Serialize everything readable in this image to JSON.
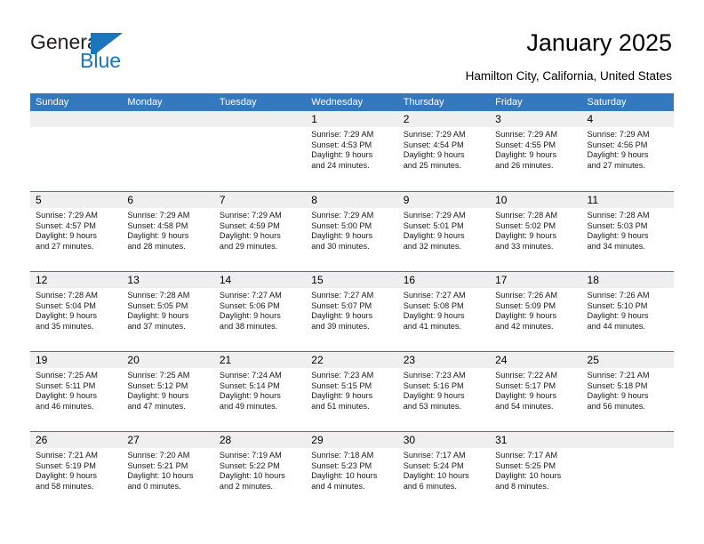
{
  "brand": {
    "name_top": "General",
    "name_bottom": "Blue",
    "mark": "triangle-logo-mark",
    "color": "#1b75bb"
  },
  "header": {
    "title": "January 2025",
    "subtitle": "Hamilton City, California, United States"
  },
  "theme": {
    "header_blue": "#3478bd",
    "daynum_band": "#efefef",
    "text": "#000000"
  },
  "calendar": {
    "day_headers": [
      "Sunday",
      "Monday",
      "Tuesday",
      "Wednesday",
      "Thursday",
      "Friday",
      "Saturday"
    ],
    "weeks": [
      [
        {
          "day": "",
          "empty": true
        },
        {
          "day": "",
          "empty": true
        },
        {
          "day": "",
          "empty": true
        },
        {
          "day": "1",
          "sunrise": "Sunrise: 7:29 AM",
          "sunset": "Sunset: 4:53 PM",
          "daylight_1": "Daylight: 9 hours",
          "daylight_2": "and 24 minutes."
        },
        {
          "day": "2",
          "sunrise": "Sunrise: 7:29 AM",
          "sunset": "Sunset: 4:54 PM",
          "daylight_1": "Daylight: 9 hours",
          "daylight_2": "and 25 minutes."
        },
        {
          "day": "3",
          "sunrise": "Sunrise: 7:29 AM",
          "sunset": "Sunset: 4:55 PM",
          "daylight_1": "Daylight: 9 hours",
          "daylight_2": "and 26 minutes."
        },
        {
          "day": "4",
          "sunrise": "Sunrise: 7:29 AM",
          "sunset": "Sunset: 4:56 PM",
          "daylight_1": "Daylight: 9 hours",
          "daylight_2": "and 27 minutes."
        }
      ],
      [
        {
          "day": "5",
          "sunrise": "Sunrise: 7:29 AM",
          "sunset": "Sunset: 4:57 PM",
          "daylight_1": "Daylight: 9 hours",
          "daylight_2": "and 27 minutes."
        },
        {
          "day": "6",
          "sunrise": "Sunrise: 7:29 AM",
          "sunset": "Sunset: 4:58 PM",
          "daylight_1": "Daylight: 9 hours",
          "daylight_2": "and 28 minutes."
        },
        {
          "day": "7",
          "sunrise": "Sunrise: 7:29 AM",
          "sunset": "Sunset: 4:59 PM",
          "daylight_1": "Daylight: 9 hours",
          "daylight_2": "and 29 minutes."
        },
        {
          "day": "8",
          "sunrise": "Sunrise: 7:29 AM",
          "sunset": "Sunset: 5:00 PM",
          "daylight_1": "Daylight: 9 hours",
          "daylight_2": "and 30 minutes."
        },
        {
          "day": "9",
          "sunrise": "Sunrise: 7:29 AM",
          "sunset": "Sunset: 5:01 PM",
          "daylight_1": "Daylight: 9 hours",
          "daylight_2": "and 32 minutes."
        },
        {
          "day": "10",
          "sunrise": "Sunrise: 7:28 AM",
          "sunset": "Sunset: 5:02 PM",
          "daylight_1": "Daylight: 9 hours",
          "daylight_2": "and 33 minutes."
        },
        {
          "day": "11",
          "sunrise": "Sunrise: 7:28 AM",
          "sunset": "Sunset: 5:03 PM",
          "daylight_1": "Daylight: 9 hours",
          "daylight_2": "and 34 minutes."
        }
      ],
      [
        {
          "day": "12",
          "sunrise": "Sunrise: 7:28 AM",
          "sunset": "Sunset: 5:04 PM",
          "daylight_1": "Daylight: 9 hours",
          "daylight_2": "and 35 minutes."
        },
        {
          "day": "13",
          "sunrise": "Sunrise: 7:28 AM",
          "sunset": "Sunset: 5:05 PM",
          "daylight_1": "Daylight: 9 hours",
          "daylight_2": "and 37 minutes."
        },
        {
          "day": "14",
          "sunrise": "Sunrise: 7:27 AM",
          "sunset": "Sunset: 5:06 PM",
          "daylight_1": "Daylight: 9 hours",
          "daylight_2": "and 38 minutes."
        },
        {
          "day": "15",
          "sunrise": "Sunrise: 7:27 AM",
          "sunset": "Sunset: 5:07 PM",
          "daylight_1": "Daylight: 9 hours",
          "daylight_2": "and 39 minutes."
        },
        {
          "day": "16",
          "sunrise": "Sunrise: 7:27 AM",
          "sunset": "Sunset: 5:08 PM",
          "daylight_1": "Daylight: 9 hours",
          "daylight_2": "and 41 minutes."
        },
        {
          "day": "17",
          "sunrise": "Sunrise: 7:26 AM",
          "sunset": "Sunset: 5:09 PM",
          "daylight_1": "Daylight: 9 hours",
          "daylight_2": "and 42 minutes."
        },
        {
          "day": "18",
          "sunrise": "Sunrise: 7:26 AM",
          "sunset": "Sunset: 5:10 PM",
          "daylight_1": "Daylight: 9 hours",
          "daylight_2": "and 44 minutes."
        }
      ],
      [
        {
          "day": "19",
          "sunrise": "Sunrise: 7:25 AM",
          "sunset": "Sunset: 5:11 PM",
          "daylight_1": "Daylight: 9 hours",
          "daylight_2": "and 46 minutes."
        },
        {
          "day": "20",
          "sunrise": "Sunrise: 7:25 AM",
          "sunset": "Sunset: 5:12 PM",
          "daylight_1": "Daylight: 9 hours",
          "daylight_2": "and 47 minutes."
        },
        {
          "day": "21",
          "sunrise": "Sunrise: 7:24 AM",
          "sunset": "Sunset: 5:14 PM",
          "daylight_1": "Daylight: 9 hours",
          "daylight_2": "and 49 minutes."
        },
        {
          "day": "22",
          "sunrise": "Sunrise: 7:23 AM",
          "sunset": "Sunset: 5:15 PM",
          "daylight_1": "Daylight: 9 hours",
          "daylight_2": "and 51 minutes."
        },
        {
          "day": "23",
          "sunrise": "Sunrise: 7:23 AM",
          "sunset": "Sunset: 5:16 PM",
          "daylight_1": "Daylight: 9 hours",
          "daylight_2": "and 53 minutes."
        },
        {
          "day": "24",
          "sunrise": "Sunrise: 7:22 AM",
          "sunset": "Sunset: 5:17 PM",
          "daylight_1": "Daylight: 9 hours",
          "daylight_2": "and 54 minutes."
        },
        {
          "day": "25",
          "sunrise": "Sunrise: 7:21 AM",
          "sunset": "Sunset: 5:18 PM",
          "daylight_1": "Daylight: 9 hours",
          "daylight_2": "and 56 minutes."
        }
      ],
      [
        {
          "day": "26",
          "sunrise": "Sunrise: 7:21 AM",
          "sunset": "Sunset: 5:19 PM",
          "daylight_1": "Daylight: 9 hours",
          "daylight_2": "and 58 minutes."
        },
        {
          "day": "27",
          "sunrise": "Sunrise: 7:20 AM",
          "sunset": "Sunset: 5:21 PM",
          "daylight_1": "Daylight: 10 hours",
          "daylight_2": "and 0 minutes."
        },
        {
          "day": "28",
          "sunrise": "Sunrise: 7:19 AM",
          "sunset": "Sunset: 5:22 PM",
          "daylight_1": "Daylight: 10 hours",
          "daylight_2": "and 2 minutes."
        },
        {
          "day": "29",
          "sunrise": "Sunrise: 7:18 AM",
          "sunset": "Sunset: 5:23 PM",
          "daylight_1": "Daylight: 10 hours",
          "daylight_2": "and 4 minutes."
        },
        {
          "day": "30",
          "sunrise": "Sunrise: 7:17 AM",
          "sunset": "Sunset: 5:24 PM",
          "daylight_1": "Daylight: 10 hours",
          "daylight_2": "and 6 minutes."
        },
        {
          "day": "31",
          "sunrise": "Sunrise: 7:17 AM",
          "sunset": "Sunset: 5:25 PM",
          "daylight_1": "Daylight: 10 hours",
          "daylight_2": "and 8 minutes."
        },
        {
          "day": "",
          "empty": true
        }
      ]
    ]
  }
}
